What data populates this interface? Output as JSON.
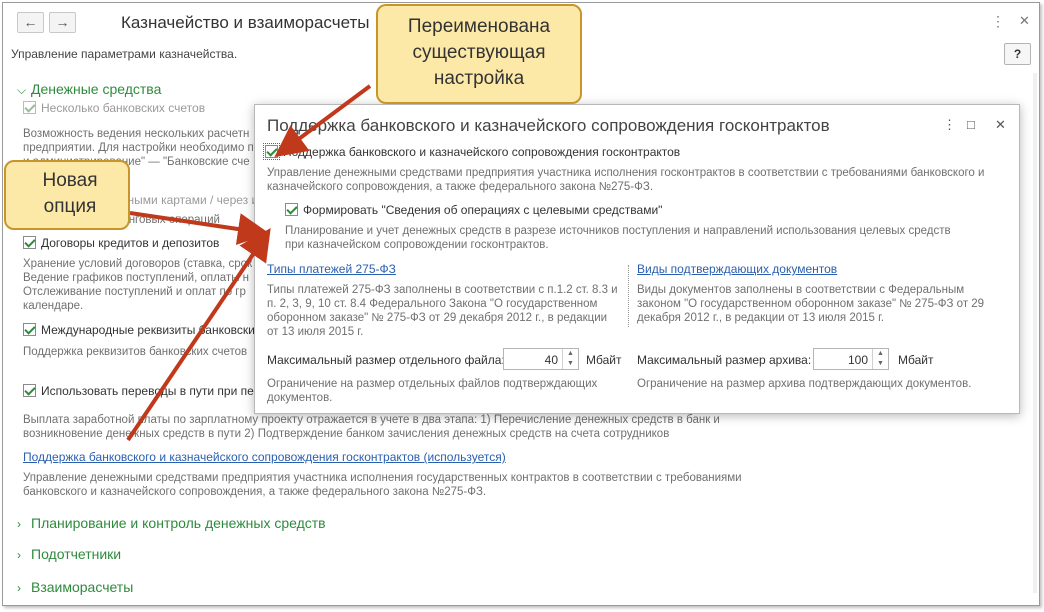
{
  "window": {
    "title": "Казначейство и взаиморасчеты",
    "back_icon": "←",
    "forward_icon": "→",
    "menu_icon": "⋮",
    "maximize_icon": "□",
    "close_icon": "✕",
    "help_label": "?"
  },
  "subtitle": "Управление параметрами казначейства.",
  "sections": {
    "money": "Денежные средства",
    "planning": "Планирование и контроль денежных средств",
    "accountables": "Подотчетники",
    "settlements": "Взаиморасчеты"
  },
  "settings": {
    "multi_accounts": {
      "label": "Несколько банковских счетов",
      "desc1": "Возможность ведения нескольких расчетн",
      "desc2": "предприятии. Для настройки необходимо п",
      "desc3": "и администрирование\" — \"Банковские сче"
    },
    "payment_cards": {
      "label": "Оплаты платежными картами / через и",
      "desc": "Поддержка эквайринговых операций"
    },
    "loans": {
      "label": "Договоры кредитов и депозитов",
      "desc1": "Хранение условий договоров (ставка, срок",
      "desc2": "Ведение графиков поступлений, оплаты н",
      "desc3": "Отслеживание поступлений и оплат по гр",
      "desc4": "календаре."
    },
    "international": {
      "label": "Международные реквизиты банковски",
      "desc": "Поддержка реквизитов банковских счетов"
    },
    "transfers": {
      "label": "Использовать переводы в пути при пер",
      "desc1": "Выплата заработной платы по зарплатному проекту отражается в учете в два этапа: 1) Перечисление денежных средств в банк и",
      "desc2": "возникновение денежных средств в пути 2) Подтверждение банком зачисления денежных средств на счета сотрудников"
    },
    "gov_link": "Поддержка банковского и казначейского сопровождения госконтрактов (используется)",
    "gov_desc1": "Управление денежными средствами предприятия участника исполнения государственных контрактов в соответствии с требованиями",
    "gov_desc2": "банковского и казначейского сопровождения, а также федерального закона №275-ФЗ."
  },
  "dialog": {
    "title": "Поддержка банковского и казначейского сопровождения госконтрактов",
    "menu_icon": "⋮",
    "maximize_icon": "□",
    "close_icon": "✕",
    "main_checkbox_label": "Поддержка банковского и казначейского сопровождения госконтрактов",
    "main_desc1": "Управление денежными средствами предприятия участника исполнения госконтрактов в соответствии с требованиями банковского и",
    "main_desc2": "казначейского сопровождения, а также федерального закона №275-ФЗ.",
    "sub_checkbox_label": "Формировать \"Сведения об операциях с целевыми средствами\"",
    "sub_desc1": "Планирование и учет денежных средств в разрезе источников поступления и направлений использования целевых средств",
    "sub_desc2": "при казначейском сопровождении госконтрактов.",
    "payment_types_link": "Типы платежей 275-ФЗ",
    "payment_types_desc1": "Типы платежей 275-ФЗ заполнены в соответствии с п.1.2 ст. 8.3 и",
    "payment_types_desc2": "п. 2, 3, 9, 10 ст. 8.4 Федерального Закона \"О государственном",
    "payment_types_desc3": "оборонном заказе\" № 275-ФЗ от 29 декабря 2012 г., в редакции",
    "payment_types_desc4": "от 13 июля 2015 г.",
    "doc_types_link": "Виды подтверждающих документов",
    "doc_types_desc1": "Виды документов заполнены в соответствии с Федеральным",
    "doc_types_desc2": "законом \"О государственном оборонном заказе\" № 275-ФЗ от 29",
    "doc_types_desc3": "декабря 2012 г., в редакции от 13 июля 2015 г.",
    "max_file_label": "Максимальный размер отдельного файла:",
    "max_file_value": "40",
    "max_file_unit": "Мбайт",
    "max_file_desc1": "Ограничение на размер отдельных файлов подтверждающих",
    "max_file_desc2": "документов.",
    "max_archive_label": "Максимальный размер архива:",
    "max_archive_value": "100",
    "max_archive_unit": "Мбайт",
    "max_archive_desc": "Ограничение на размер архива подтверждающих документов."
  },
  "callouts": {
    "renamed": [
      "Переименована",
      "существующая",
      "настройка"
    ],
    "new_option": [
      "Новая",
      "опция"
    ]
  },
  "colors": {
    "section_green": "#2e8b3d",
    "link_blue": "#2a5fb0",
    "callout_fill": "#fde9a7",
    "callout_border": "#c8952a",
    "arrow": "#c0391b"
  }
}
